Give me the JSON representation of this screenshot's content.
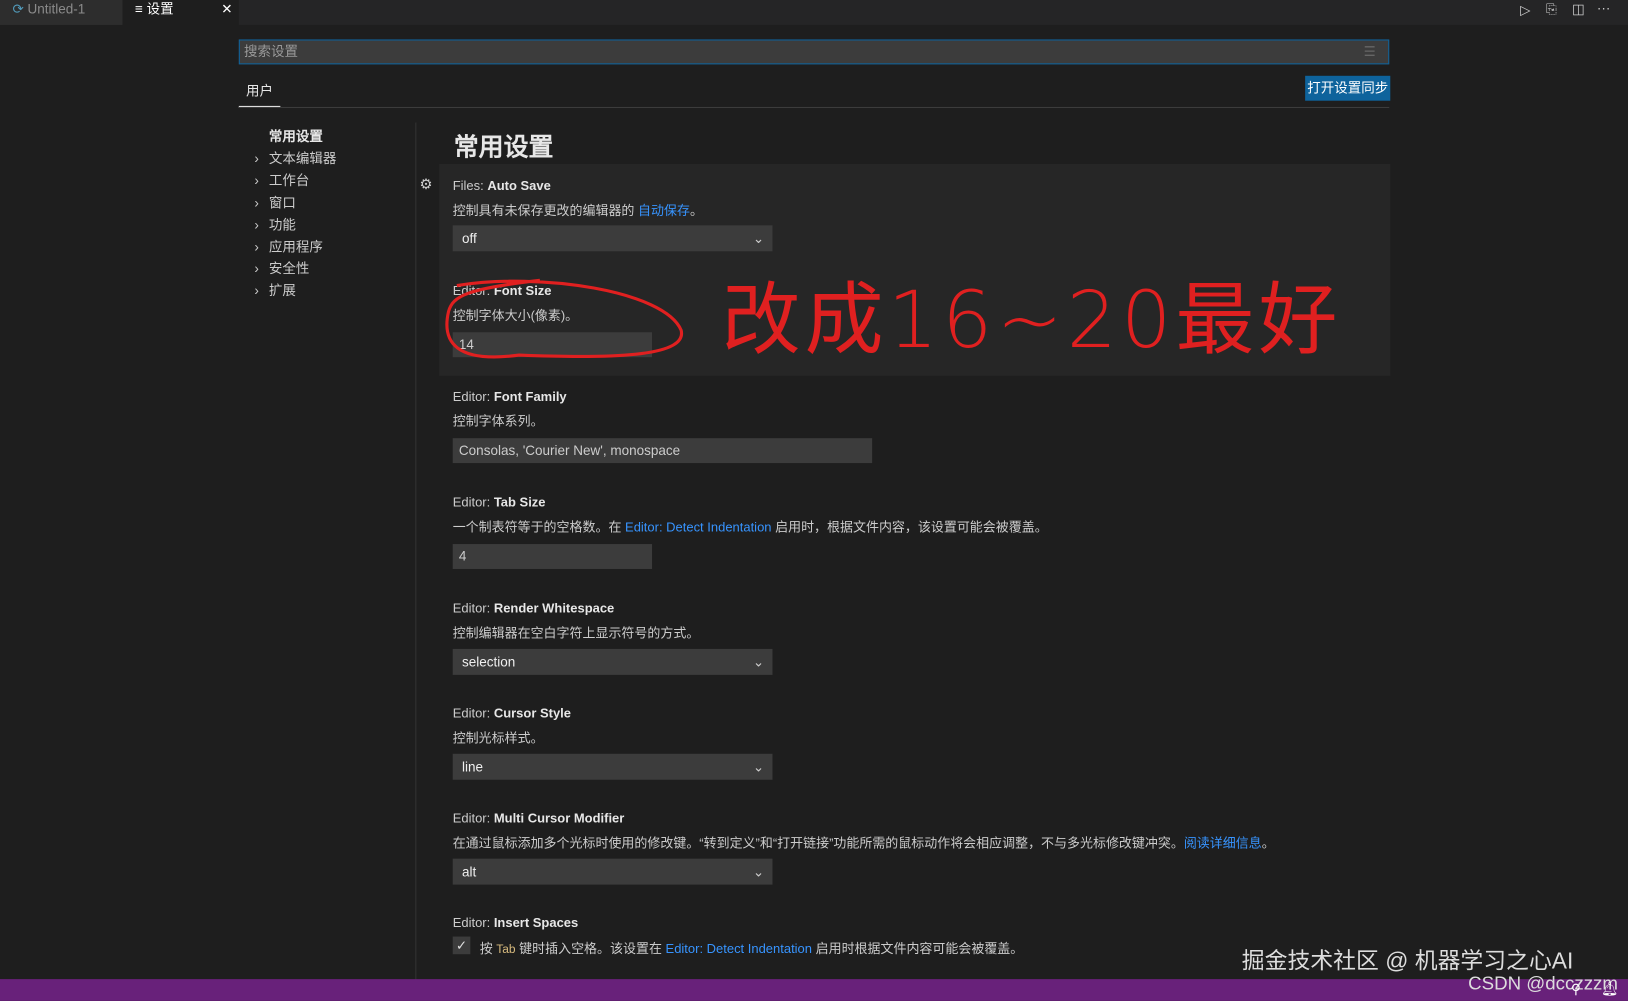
{
  "tabs": [
    {
      "label": "Untitled-1",
      "icon": "file-icon"
    },
    {
      "label": "设置",
      "icon": "settings-editor-icon"
    }
  ],
  "toolbar_icons": [
    "run-icon",
    "open-settings-json-icon",
    "split-editor-icon",
    "more-icon"
  ],
  "search": {
    "placeholder": "搜索设置"
  },
  "scope_tab": "用户",
  "sync_button": "打开设置同步",
  "toc": [
    {
      "label": "常用设置",
      "expandable": false
    },
    {
      "label": "文本编辑器",
      "expandable": true
    },
    {
      "label": "工作台",
      "expandable": true
    },
    {
      "label": "窗口",
      "expandable": true
    },
    {
      "label": "功能",
      "expandable": true
    },
    {
      "label": "应用程序",
      "expandable": true
    },
    {
      "label": "安全性",
      "expandable": true
    },
    {
      "label": "扩展",
      "expandable": true
    }
  ],
  "section_title": "常用设置",
  "settings": {
    "auto_save": {
      "cat": "Files: ",
      "name": "Auto Save",
      "desc": "控制具有未保存更改的编辑器的 ",
      "link": "自动保存",
      "end": "。",
      "value": "off"
    },
    "font_size": {
      "cat": "Editor: ",
      "name": "Font Size",
      "desc": "控制字体大小(像素)。",
      "value": "14"
    },
    "font_family": {
      "cat": "Editor: ",
      "name": "Font Family",
      "desc": "控制字体系列。",
      "value": "Consolas, 'Courier New', monospace"
    },
    "tab_size": {
      "cat": "Editor: ",
      "name": "Tab Size",
      "desc1": "一个制表符等于的空格数。在 ",
      "link": "Editor: Detect Indentation",
      "desc2": " 启用时，根据文件内容，该设置可能会被覆盖。",
      "value": "4"
    },
    "render_whitespace": {
      "cat": "Editor: ",
      "name": "Render Whitespace",
      "desc": "控制编辑器在空白字符上显示符号的方式。",
      "value": "selection"
    },
    "cursor_style": {
      "cat": "Editor: ",
      "name": "Cursor Style",
      "desc": "控制光标样式。",
      "value": "line"
    },
    "multi_cursor": {
      "cat": "Editor: ",
      "name": "Multi Cursor Modifier",
      "desc": "在通过鼠标添加多个光标时使用的修改键。“转到定义”和“打开链接”功能所需的鼠标动作将会相应调整，不与多光标修改键冲突。",
      "link": "阅读详细信息",
      "end": "。",
      "value": "alt"
    },
    "insert_spaces": {
      "cat": "Editor: ",
      "name": "Insert Spaces",
      "d1": "按 ",
      "key": "Tab",
      "d2": " 键时插入空格。该设置在 ",
      "link": "Editor: Detect Indentation",
      "d3": " 启用时根据文件内容可能会被覆盖。",
      "checked": true
    }
  },
  "annotation": "改成16~20最好",
  "watermark": "掘金技术社区 @ 机器学习之心AI",
  "watermark2": "CSDN @dcczzzm",
  "colors": {
    "accent": "#0e639c",
    "status_bar": "#68217a",
    "link": "#3794ff",
    "annotation": "#e02020"
  }
}
